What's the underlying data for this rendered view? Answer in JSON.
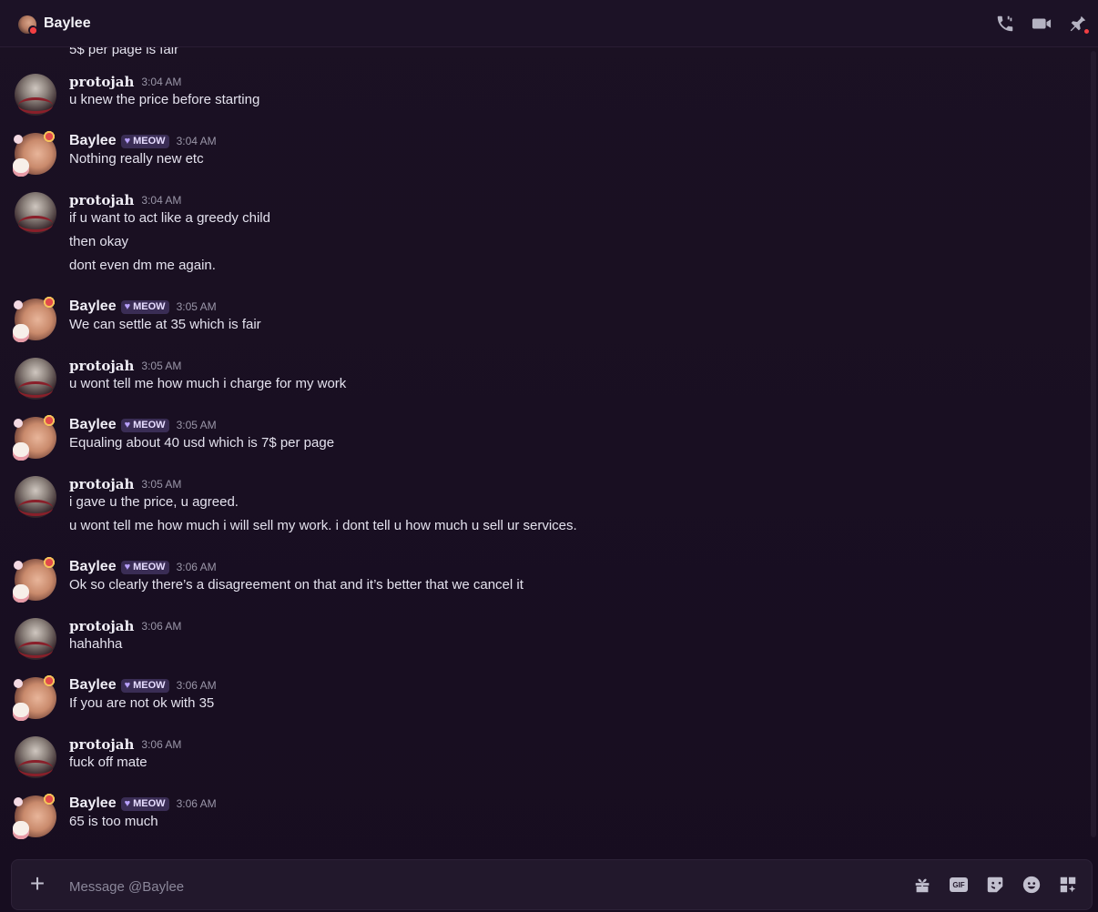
{
  "header": {
    "title": "Baylee",
    "icons": [
      "voice-call-icon",
      "video-call-icon",
      "pinned-messages-icon"
    ]
  },
  "partial_message": {
    "text": "5$ per page is fair"
  },
  "messages": [
    {
      "author": "protojah",
      "badge": "",
      "time": "3:04 AM",
      "lines": [
        "u knew the price before starting"
      ]
    },
    {
      "author": "Baylee",
      "badge": "MEOW",
      "time": "3:04 AM",
      "lines": [
        "Nothing really new etc"
      ]
    },
    {
      "author": "protojah",
      "badge": "",
      "time": "3:04 AM",
      "lines": [
        "if u want to act like a greedy child",
        "then okay",
        "dont even dm me again."
      ]
    },
    {
      "author": "Baylee",
      "badge": "MEOW",
      "time": "3:05 AM",
      "lines": [
        "We can settle at 35 which is fair"
      ]
    },
    {
      "author": "protojah",
      "badge": "",
      "time": "3:05 AM",
      "lines": [
        "u wont tell me how much i charge for my work"
      ]
    },
    {
      "author": "Baylee",
      "badge": "MEOW",
      "time": "3:05 AM",
      "lines": [
        "Equaling about 40 usd which is 7$ per page"
      ]
    },
    {
      "author": "protojah",
      "badge": "",
      "time": "3:05 AM",
      "lines": [
        "i gave u the price, u agreed.",
        "u wont tell me how much i will sell my work. i dont tell u how much u sell ur services."
      ]
    },
    {
      "author": "Baylee",
      "badge": "MEOW",
      "time": "3:06 AM",
      "lines": [
        "Ok so clearly there’s a disagreement on that and it’s better that we cancel it"
      ]
    },
    {
      "author": "protojah",
      "badge": "",
      "time": "3:06 AM",
      "lines": [
        "hahahha"
      ]
    },
    {
      "author": "Baylee",
      "badge": "MEOW",
      "time": "3:06 AM",
      "lines": [
        "If you are not ok with 35"
      ]
    },
    {
      "author": "protojah",
      "badge": "",
      "time": "3:06 AM",
      "lines": [
        "fuck off mate"
      ]
    },
    {
      "author": "Baylee",
      "badge": "MEOW",
      "time": "3:06 AM",
      "lines": [
        "65 is too much"
      ]
    }
  ],
  "composer": {
    "placeholder": "Message @Baylee",
    "value": "",
    "icons": [
      "gift-icon",
      "gif-icon",
      "sticker-icon",
      "emoji-icon",
      "apps-icon"
    ],
    "gif_label": "GIF"
  },
  "colors": {
    "background": "#1a0f22",
    "badge": "#3a2d55",
    "status_dnd": "#f23f43"
  }
}
